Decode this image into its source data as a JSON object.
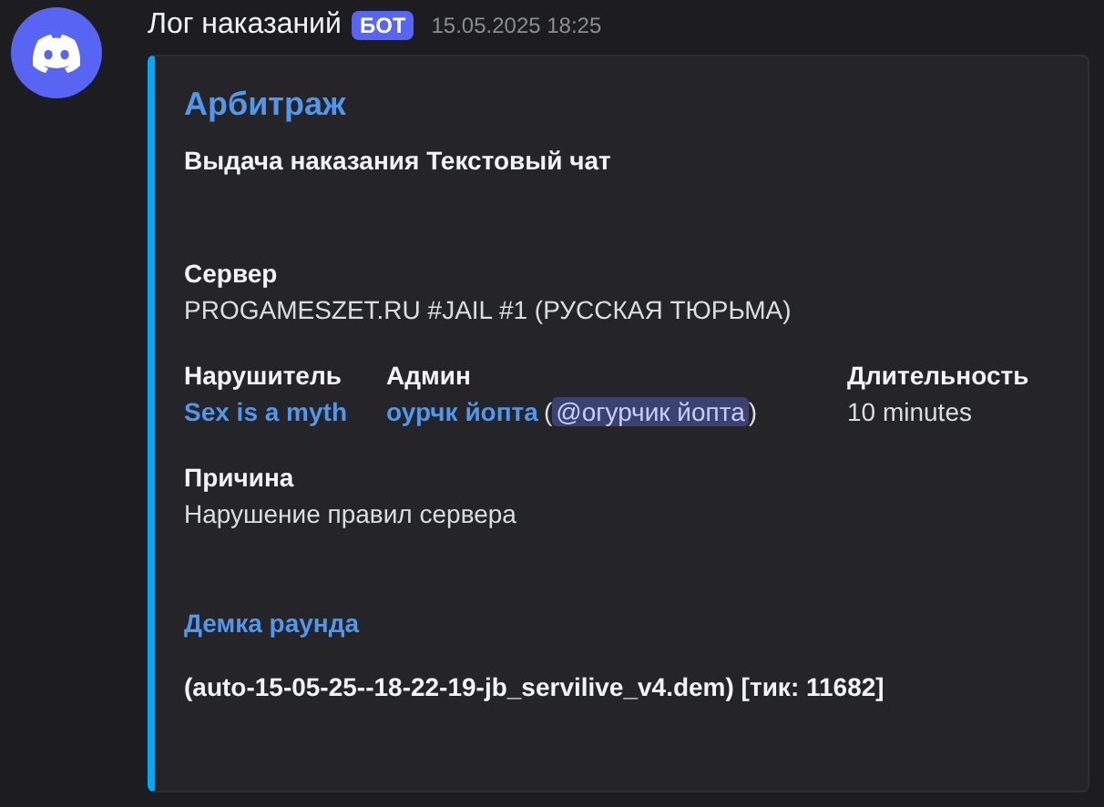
{
  "message": {
    "author": "Лог наказаний",
    "badge": "БОТ",
    "timestamp": "15.05.2025 18:25"
  },
  "embed": {
    "title": "Арбитраж",
    "description": "Выдача наказания Текстовый чат",
    "fields": [
      {
        "name": "Сервер",
        "inline": false,
        "name_link": false,
        "bold_value": false,
        "value": [
          {
            "kind": "text",
            "text": "PROGAMESZET.RU #JAIL #1 (РУССКАЯ ТЮРЬМА)"
          }
        ]
      },
      {
        "name": "Нарушитель",
        "inline": true,
        "name_link": false,
        "bold_value": false,
        "value": [
          {
            "kind": "link",
            "text": "Sex is a myth"
          }
        ]
      },
      {
        "name": "Админ",
        "inline": true,
        "name_link": false,
        "bold_value": false,
        "value": [
          {
            "kind": "link",
            "text": "оурчк йопта"
          },
          {
            "kind": "text",
            "text": "("
          },
          {
            "kind": "mention",
            "text": "@огурчик йопта"
          },
          {
            "kind": "text",
            "text": ")"
          }
        ]
      },
      {
        "name": "Длительность",
        "inline": true,
        "name_link": false,
        "bold_value": false,
        "value": [
          {
            "kind": "text",
            "text": "10 minutes"
          }
        ]
      },
      {
        "name": "Причина",
        "inline": false,
        "name_link": false,
        "bold_value": false,
        "value": [
          {
            "kind": "text",
            "text": "Нарушение правил сервера"
          }
        ]
      },
      {
        "name": "Демка раунда",
        "inline": false,
        "name_link": true,
        "bold_value": true,
        "value": [
          {
            "kind": "text",
            "text": "(auto-15-05-25--18-22-19-jb_servilive_v4.dem) [тик: 11682]"
          }
        ]
      }
    ]
  }
}
